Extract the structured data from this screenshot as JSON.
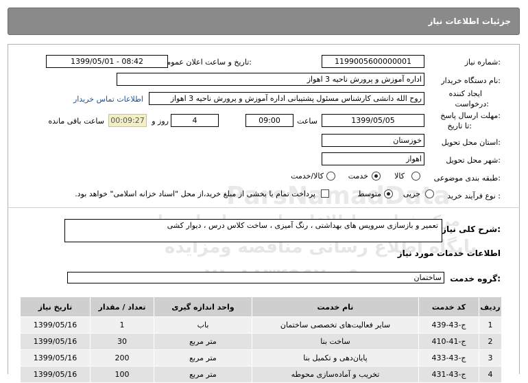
{
  "page_title": "جزئیات اطلاعات نیاز",
  "fields": {
    "need_number_label": "شماره نیاز:",
    "need_number": "1199005600000001",
    "announce_label": "تاریخ و ساعت اعلان عمومی:",
    "announce_value": "1399/05/01 - 08:42",
    "buyer_label": "نام دستگاه خریدار:",
    "buyer_value": "اداره آموزش و پرورش ناحیه 3 اهواز",
    "creator_label_1": "ایجاد کننده",
    "creator_label_2": "درخواست:",
    "creator_value": "روح الله دانشی کارشناس مسئول پشتیبانی  اداره آموزش و پرورش ناحیه 3 اهواز",
    "contact_link": "اطلاعات تماس خریدار",
    "deadline_label_1": "مهلت ارسال پاسخ:",
    "deadline_label_2": "تا تاریخ:",
    "deadline_date": "1399/05/05",
    "time_label": "ساعت",
    "deadline_time": "09:00",
    "days_value": "4",
    "days_label": "روز و",
    "remaining_time": "00:09:27",
    "remaining_label": "ساعت باقی مانده",
    "province_label": "استان محل تحویل:",
    "province_value": "خوزستان",
    "city_label": "شهر محل تحویل:",
    "city_value": "اهواز",
    "category_label": "طبقه بندی موضوعی:",
    "category_options": [
      "کالا",
      "خدمت",
      "کالا/خدمت"
    ],
    "category_selected": "خدمت",
    "process_label": "نوع فرآیند خرید :",
    "process_options": [
      "جزیی",
      "متوسط"
    ],
    "process_selected": "متوسط",
    "payment_note": "پرداخت تمام یا بخشی از مبلغ خرید،از محل \"اسناد خزانه اسلامی\" خواهد بود."
  },
  "description": {
    "label": "شرح کلی نیاز:",
    "text": "تعمیر و بازسازی سرویس های بهداشتی ، رنگ آمیزی ، ساخت کلاس درس ، دیوار کشی"
  },
  "services_heading": "اطلاعات خدمات مورد نیاز",
  "service_group": {
    "label": "گروه خدمت:",
    "value": "ساختمان"
  },
  "table": {
    "headers": [
      "ردیف",
      "کد خدمت",
      "نام خدمت",
      "واحد اندازه گیری",
      "تعداد / مقدار",
      "تاریخ نیاز"
    ],
    "rows": [
      [
        "1",
        "ج-43-439",
        "سایر فعالیت‌های تخصصی ساختمان",
        "باب",
        "1",
        "1399/05/16"
      ],
      [
        "2",
        "ج-41-410",
        "ساخت بنا",
        "متر مربع",
        "30",
        "1399/05/16"
      ],
      [
        "3",
        "ج-43-433",
        "پایان‌دهی و تکمیل بنا",
        "متر مربع",
        "200",
        "1399/05/16"
      ],
      [
        "4",
        "ج-43-431",
        "تخریب و آماده‌سازی محوطه",
        "متر مربع",
        "100",
        "1399/05/16"
      ]
    ]
  },
  "watermark": {
    "line1": "ParsNamadData",
    "line2": "مرکز فراوری اطلاعات پارس نماد داده ها",
    "line3": "پایگاه اطلاع رسانی مناقصه ومزایده",
    "line4": "۰۲۱-۸۸۳۴۹۶۷۰-۵"
  }
}
